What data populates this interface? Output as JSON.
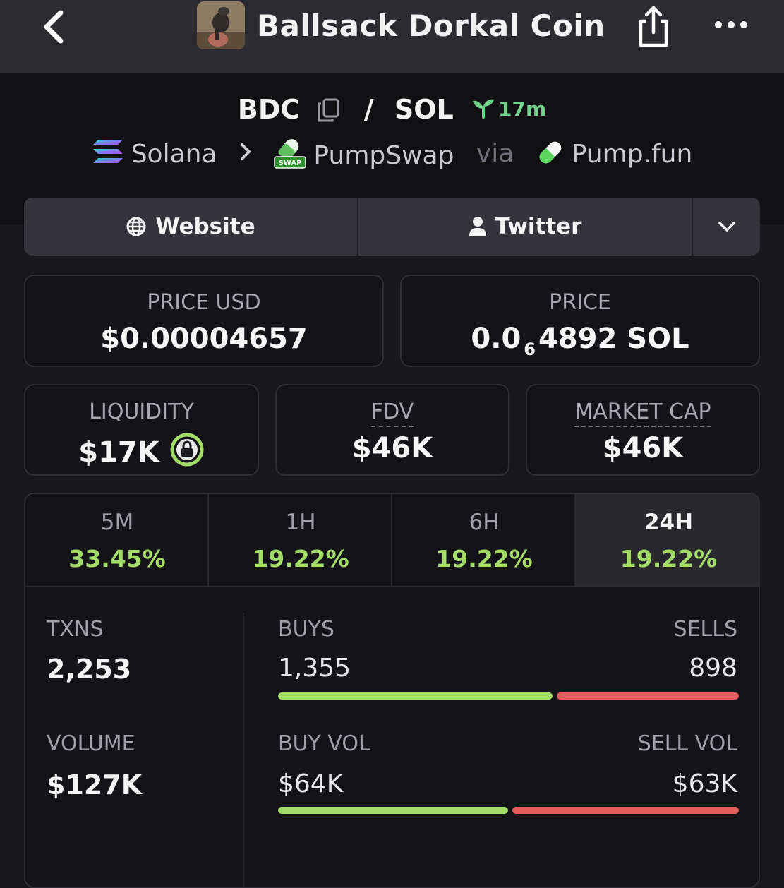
{
  "header": {
    "title": "Ballsack Dorkal Coin"
  },
  "pair": {
    "base": "BDC",
    "separator": "/",
    "quote": "SOL",
    "age": "17m"
  },
  "route": {
    "chain": "Solana",
    "dex": "PumpSwap",
    "via": "via",
    "launchpad": "Pump.fun",
    "dex_badge_text": "SWAP"
  },
  "links": {
    "website": "Website",
    "twitter": "Twitter"
  },
  "stats": {
    "price_usd": {
      "label": "PRICE USD",
      "value": "$0.00004657"
    },
    "price_native": {
      "label": "PRICE",
      "prefix": "0.0",
      "zeros": "6",
      "digits": "4892",
      "unit": "SOL"
    },
    "liquidity": {
      "label": "LIQUIDITY",
      "value": "$17K"
    },
    "fdv": {
      "label": "FDV",
      "value": "$46K"
    },
    "market_cap": {
      "label": "MARKET CAP",
      "value": "$46K"
    }
  },
  "timeframes": [
    {
      "name": "5M",
      "change": "33.45%"
    },
    {
      "name": "1H",
      "change": "19.22%"
    },
    {
      "name": "6H",
      "change": "19.22%"
    },
    {
      "name": "24H",
      "change": "19.22%",
      "active": true
    }
  ],
  "metrics": {
    "txns": {
      "label": "TXNS",
      "value": "2,253"
    },
    "buys": {
      "label": "BUYS",
      "value": "1,355",
      "share": 0.601
    },
    "sells": {
      "label": "SELLS",
      "value": "898",
      "share": 0.399
    },
    "volume": {
      "label": "VOLUME",
      "value": "$127K"
    },
    "buy_vol": {
      "label": "BUY VOL",
      "value": "$64K",
      "share": 0.504
    },
    "sell_vol": {
      "label": "SELL VOL",
      "value": "$63K",
      "share": 0.496
    }
  },
  "colors": {
    "positive": "#a4dc6a",
    "negative": "#e35d5d",
    "age": "#6fd28a"
  }
}
